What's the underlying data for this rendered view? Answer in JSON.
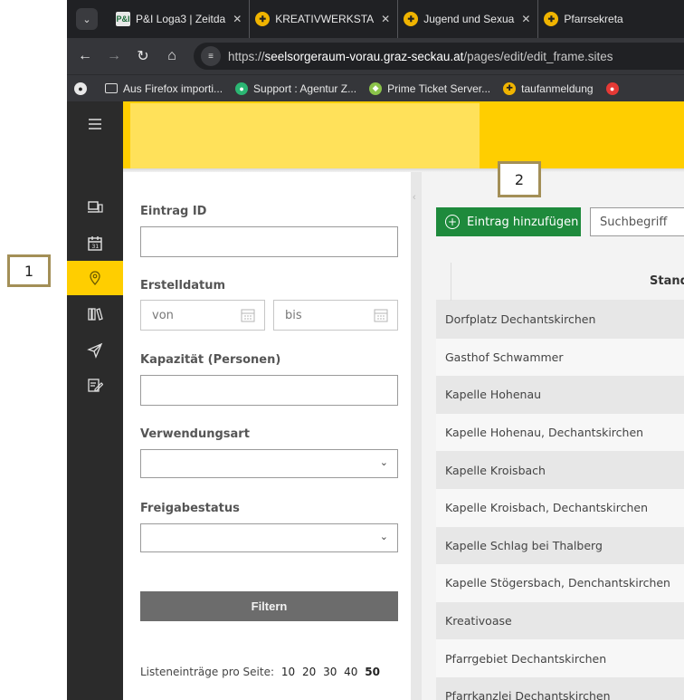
{
  "callouts": {
    "one": "1",
    "two": "2"
  },
  "browser": {
    "tabs": [
      {
        "favicon": "P&I",
        "title": "P&I Loga3 | Zeitda",
        "close": "✕"
      },
      {
        "favicon": "kreativ",
        "title": "KREATIVWERKSTA",
        "close": "✕"
      },
      {
        "favicon": "kreativ",
        "title": "Jugend und Sexua",
        "close": "✕"
      },
      {
        "favicon": "kreativ",
        "title": "Pfarrsekreta",
        "close": ""
      }
    ],
    "url_prefix": "https://",
    "url_host": "seelsorgeraum-vorau.graz-seckau.at",
    "url_path": "/pages/edit/edit_frame.sites",
    "bookmarks": [
      {
        "icon": "folder-icon",
        "label": "Aus Firefox importi..."
      },
      {
        "icon": "support-icon",
        "label": "Support : Agentur Z..."
      },
      {
        "icon": "ticket-icon",
        "label": "Prime Ticket Server..."
      },
      {
        "icon": "kreativ-icon",
        "label": "taufanmeldung"
      }
    ]
  },
  "sidenav": {
    "items": [
      "menu-icon",
      "devices-icon",
      "calendar-icon",
      "location-pin-icon",
      "library-icon",
      "send-icon",
      "edit-note-icon"
    ],
    "active": "location-pin-icon"
  },
  "filters": {
    "entry_id_label": "Eintrag ID",
    "created_label": "Erstelldatum",
    "date_from_placeholder": "von",
    "date_to_placeholder": "bis",
    "capacity_label": "Kapazität (Personen)",
    "usage_label": "Verwendungsart",
    "release_label": "Freigabestatus",
    "filter_button": "Filtern",
    "per_page_label": "Listeneinträge pro Seite:",
    "per_page_options": [
      "10",
      "20",
      "30",
      "40",
      "50"
    ],
    "per_page_selected": "50"
  },
  "main": {
    "add_button": "Eintrag hinzufügen",
    "search_placeholder": "Suchbegriff",
    "column_header": "Standort",
    "rows": [
      "Dorfplatz Dechantskirchen",
      "Gasthof Schwammer",
      "Kapelle Hohenau",
      "Kapelle Hohenau, Dechantskirchen",
      "Kapelle Kroisbach",
      "Kapelle Kroisbach, Dechantskirchen",
      "Kapelle Schlag bei Thalberg",
      "Kapelle Stögersbach, Denchantskirchen",
      "Kreativoase",
      "Pfarrgebiet Dechantskirchen",
      "Pfarrkanzlei Dechantskirchen"
    ]
  },
  "colors": {
    "brand_yellow": "#ffce00",
    "add_green": "#1e8a3c",
    "nav_dark": "#2b2b2b",
    "callout_border": "#a38f57"
  }
}
